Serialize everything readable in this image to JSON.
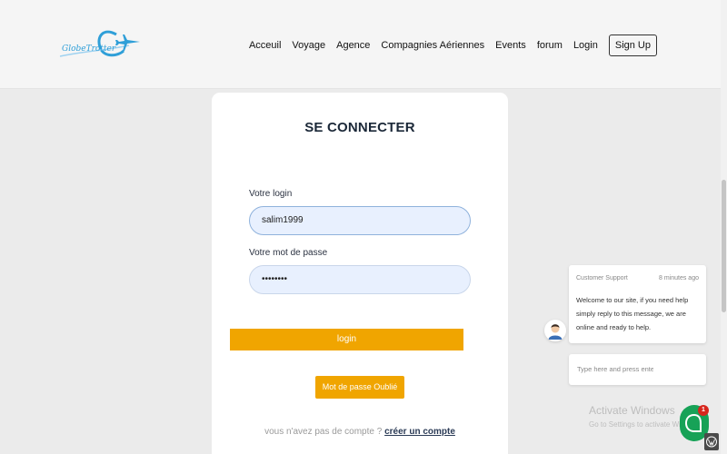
{
  "header": {
    "logo_text": "GlobeTrotter",
    "nav": [
      "Acceuil",
      "Voyage",
      "Agence",
      "Compagnies Aériennes",
      "Events",
      "forum",
      "Login"
    ],
    "signup": "Sign Up"
  },
  "form": {
    "title": "SE CONNECTER",
    "login_label": "Votre login",
    "login_value": "salim1999",
    "password_label": "Votre mot de passe",
    "password_value": "••••••••",
    "login_button": "login",
    "forgot_button": "Mot de passe Oublié",
    "no_account_text": "vous n'avez pas de compte ?",
    "create_account_link": "créer un compte"
  },
  "chat": {
    "agent": "Customer Support",
    "time": "8 minutes ago",
    "message": "Welcome to our site, if you need help simply reply to this message, we are online and ready to help.",
    "input_placeholder": "Type here and press enter..",
    "unread_count": "1"
  },
  "watermark": {
    "title": "Activate Windows",
    "subtitle": "Go to Settings to activate Windows."
  },
  "colors": {
    "accent": "#f0a500",
    "chat_green": "#17a257",
    "badge_red": "#d7261d"
  }
}
